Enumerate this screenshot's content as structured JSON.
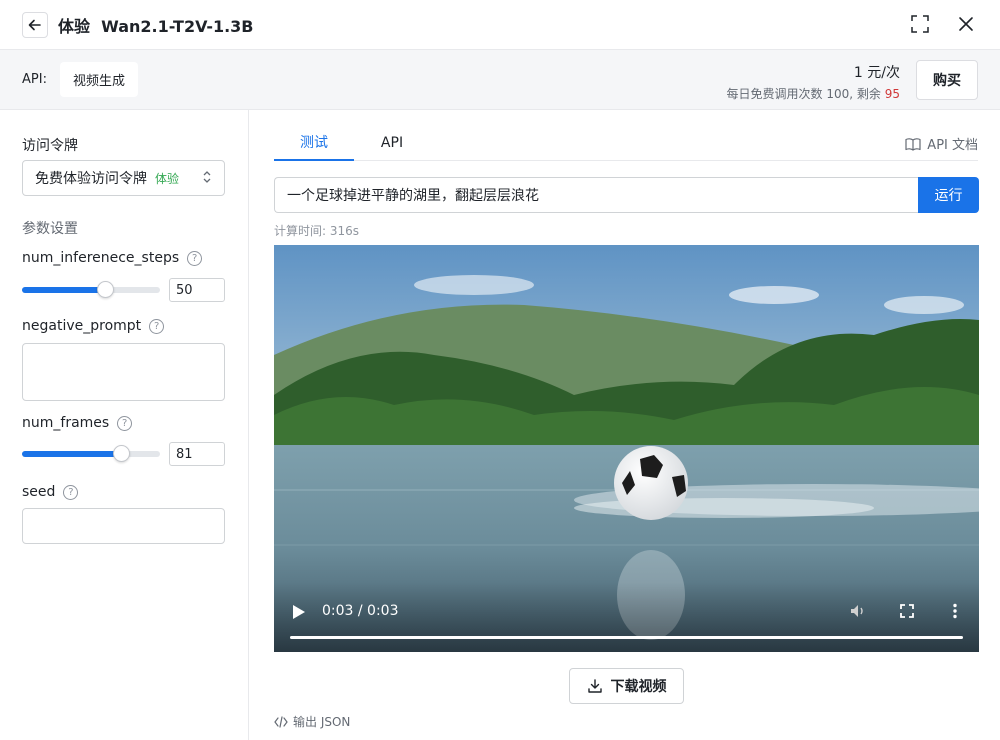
{
  "header": {
    "title_prefix": "体验",
    "model_name": "Wan2.1-T2V-1.3B"
  },
  "topbar": {
    "api_label": "API:",
    "api_tag": "视频生成",
    "price": "1 元/次",
    "quota_text": "每日免费调用次数 100, 剩余",
    "quota_remaining": "95",
    "buy_label": "购买"
  },
  "left": {
    "token_label": "访问令牌",
    "token_value": "免费体验访问令牌",
    "token_tag": "体验",
    "params_title": "参数设置",
    "params": [
      {
        "name": "num_inferenece_steps",
        "value": "50",
        "fraction": 0.6
      },
      {
        "name": "negative_prompt",
        "value": ""
      },
      {
        "name": "num_frames",
        "value": "81",
        "fraction": 0.72
      },
      {
        "name": "seed",
        "value": ""
      }
    ]
  },
  "right": {
    "tabs": [
      {
        "label": "测试",
        "active": true
      },
      {
        "label": "API",
        "active": false
      }
    ],
    "docs_label": "API 文档",
    "prompt_value": "一个足球掉进平静的湖里，翻起层层浪花",
    "run_label": "运行",
    "calc_time": "计算时间: 316s",
    "video_time": "0:03 / 0:03",
    "video_progress": 1.0,
    "download_label": "下载视频",
    "json_label": "输出 JSON"
  },
  "colors": {
    "accent": "#1a73e8",
    "remain": "#d03838",
    "tag_green": "#34a853"
  }
}
